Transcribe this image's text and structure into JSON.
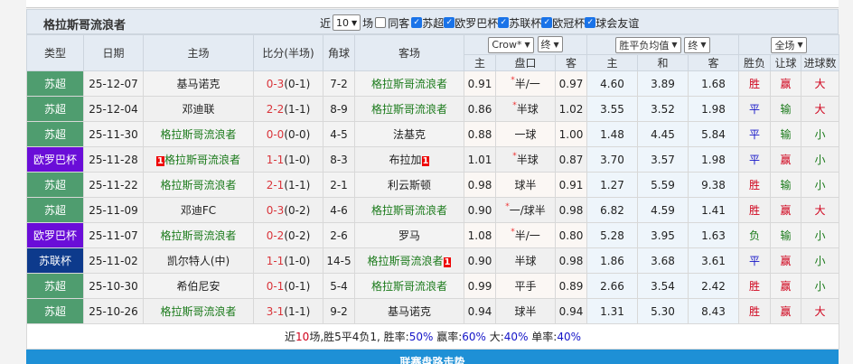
{
  "header": {
    "team": "格拉斯哥流浪者",
    "near_label": "近",
    "count": "10",
    "count_unit": "场",
    "same_guest": "同客",
    "leagues": [
      "苏超",
      "欧罗巴杯",
      "苏联杯",
      "欧冠杯",
      "球会友谊"
    ]
  },
  "columns": {
    "type": "类型",
    "date": "日期",
    "home": "主场",
    "score": "比分(半场)",
    "corner": "角球",
    "away": "客场",
    "company": "Crow*",
    "hc_period": "终",
    "odds_type": "胜平负均值",
    "odds_period": "终",
    "scope": "全场",
    "sub": [
      "主",
      "盘口",
      "客",
      "主",
      "和",
      "客",
      "胜负",
      "让球",
      "进球数"
    ]
  },
  "colors": {
    "su_chao": "#4f9d6f",
    "europa": "#6a0dd8",
    "league_cup": "#0d3a8c",
    "summary_blue": "#1e90d6"
  },
  "rows": [
    {
      "type": "苏超",
      "lc": "su_chao",
      "date": "25-12-07",
      "home": "基马诺克",
      "home_us": false,
      "score": "0-3",
      "half": "(0-1)",
      "corner": "7-2",
      "away": "格拉斯哥流浪者",
      "away_us": true,
      "h": "0.91",
      "pk": "半/一",
      "star": true,
      "a": "0.97",
      "o1": "4.60",
      "ox": "3.89",
      "o2": "1.68",
      "res": "胜",
      "rang": "赢",
      "goals": "大"
    },
    {
      "type": "苏超",
      "lc": "su_chao",
      "date": "25-12-04",
      "home": "邓迪联",
      "home_us": false,
      "score": "2-2",
      "half": "(1-1)",
      "corner": "8-9",
      "away": "格拉斯哥流浪者",
      "away_us": true,
      "h": "0.86",
      "pk": "半球",
      "star": true,
      "a": "1.02",
      "o1": "3.55",
      "ox": "3.52",
      "o2": "1.98",
      "res": "平",
      "rang": "输",
      "goals": "大"
    },
    {
      "type": "苏超",
      "lc": "su_chao",
      "date": "25-11-30",
      "home": "格拉斯哥流浪者",
      "home_us": true,
      "score": "0-0",
      "half": "(0-0)",
      "corner": "4-5",
      "away": "法基克",
      "away_us": false,
      "h": "0.88",
      "pk": "一球",
      "star": false,
      "a": "1.00",
      "o1": "1.48",
      "ox": "4.45",
      "o2": "5.84",
      "res": "平",
      "rang": "输",
      "goals": "小"
    },
    {
      "type": "欧罗巴杯",
      "lc": "europa",
      "date": "25-11-28",
      "home": "格拉斯哥流浪者",
      "home_us": true,
      "home_card": "1",
      "score": "1-1",
      "half": "(1-0)",
      "corner": "8-3",
      "away": "布拉加",
      "away_us": false,
      "away_card": "1",
      "h": "1.01",
      "pk": "半球",
      "star": true,
      "a": "0.87",
      "o1": "3.70",
      "ox": "3.57",
      "o2": "1.98",
      "res": "平",
      "rang": "赢",
      "goals": "小"
    },
    {
      "type": "苏超",
      "lc": "su_chao",
      "date": "25-11-22",
      "home": "格拉斯哥流浪者",
      "home_us": true,
      "score": "2-1",
      "half": "(1-1)",
      "corner": "2-1",
      "away": "利云斯顿",
      "away_us": false,
      "h": "0.98",
      "pk": "球半",
      "star": false,
      "a": "0.91",
      "o1": "1.27",
      "ox": "5.59",
      "o2": "9.38",
      "res": "胜",
      "rang": "输",
      "goals": "小"
    },
    {
      "type": "苏超",
      "lc": "su_chao",
      "date": "25-11-09",
      "home": "邓迪FC",
      "home_us": false,
      "score": "0-3",
      "half": "(0-2)",
      "corner": "4-6",
      "away": "格拉斯哥流浪者",
      "away_us": true,
      "h": "0.90",
      "pk": "一/球半",
      "star": true,
      "a": "0.98",
      "o1": "6.82",
      "ox": "4.59",
      "o2": "1.41",
      "res": "胜",
      "rang": "赢",
      "goals": "大"
    },
    {
      "type": "欧罗巴杯",
      "lc": "europa",
      "date": "25-11-07",
      "home": "格拉斯哥流浪者",
      "home_us": true,
      "score": "0-2",
      "half": "(0-2)",
      "corner": "2-6",
      "away": "罗马",
      "away_us": false,
      "h": "1.08",
      "pk": "半/一",
      "star": true,
      "a": "0.80",
      "o1": "5.28",
      "ox": "3.95",
      "o2": "1.63",
      "res": "负",
      "rang": "输",
      "goals": "小"
    },
    {
      "type": "苏联杯",
      "lc": "league_cup",
      "date": "25-11-02",
      "home": "凯尔特人(中)",
      "home_us": false,
      "score": "1-1",
      "half": "(1-0)",
      "corner": "14-5",
      "away": "格拉斯哥流浪者",
      "away_us": true,
      "away_card": "1",
      "h": "0.90",
      "pk": "半球",
      "star": false,
      "a": "0.98",
      "o1": "1.86",
      "ox": "3.68",
      "o2": "3.61",
      "res": "平",
      "rang": "赢",
      "goals": "小"
    },
    {
      "type": "苏超",
      "lc": "su_chao",
      "date": "25-10-30",
      "home": "希伯尼安",
      "home_us": false,
      "score": "0-1",
      "half": "(0-1)",
      "corner": "5-4",
      "away": "格拉斯哥流浪者",
      "away_us": true,
      "h": "0.99",
      "pk": "平手",
      "star": false,
      "a": "0.89",
      "o1": "2.66",
      "ox": "3.54",
      "o2": "2.42",
      "res": "胜",
      "rang": "赢",
      "goals": "小"
    },
    {
      "type": "苏超",
      "lc": "su_chao",
      "date": "25-10-26",
      "home": "格拉斯哥流浪者",
      "home_us": true,
      "score": "3-1",
      "half": "(1-1)",
      "corner": "9-2",
      "away": "基马诺克",
      "away_us": false,
      "h": "0.94",
      "pk": "球半",
      "star": false,
      "a": "0.94",
      "o1": "1.31",
      "ox": "5.30",
      "o2": "8.43",
      "res": "胜",
      "rang": "赢",
      "goals": "大"
    }
  ],
  "summary": {
    "p1": "近",
    "n": "10",
    "p2": "场,胜5平4负1, 胜率:",
    "win": "50%",
    "p3": " 赢率:",
    "rang": "60%",
    "p4": " 大:",
    "big": "40%",
    "p5": " 单率:",
    "odd": "40%"
  },
  "footer": {
    "title": "联赛盘路走势"
  }
}
